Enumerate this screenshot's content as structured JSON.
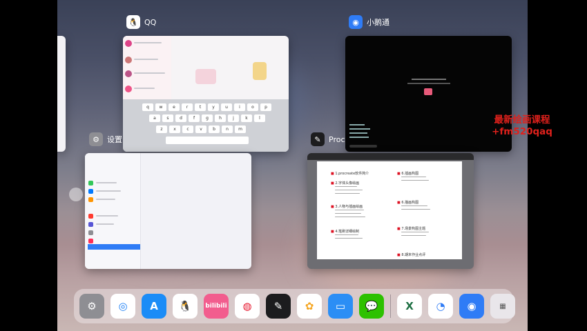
{
  "switcher": {
    "apps": [
      {
        "id": "qq",
        "label": "QQ",
        "icon": "qq-icon"
      },
      {
        "id": "xiaoetong",
        "label": "小鹅通",
        "icon": "xiaoetong-icon"
      },
      {
        "id": "settings",
        "label": "设置",
        "icon": "settings-gear-icon"
      },
      {
        "id": "procreate",
        "label": "Proc",
        "icon": "procreate-icon"
      }
    ],
    "overlay_text": [
      "最新绘画课程",
      "+fm520qaq"
    ]
  },
  "procreate_notes": {
    "items": [
      "1.procreate软件简介",
      "2.字体头像绘画",
      "3.人物与插画绘画",
      "4.笔刷详细绘制",
      "6.插画构图",
      "6.描画构图",
      "7.场景构图主题",
      "8.期末作业点评"
    ]
  },
  "dock": {
    "apps": [
      "settings",
      "safari",
      "app-store",
      "qq",
      "bilibili",
      "weibo",
      "procreate",
      "photos",
      "files",
      "wechat",
      "excel",
      "clock-app",
      "xiaoetong",
      "app-library"
    ],
    "bilibili_label": "bilibili",
    "excel_label": "X"
  },
  "colors": {
    "accent_red": "#e0211c",
    "procreate_dark": "#1c1c1e"
  }
}
